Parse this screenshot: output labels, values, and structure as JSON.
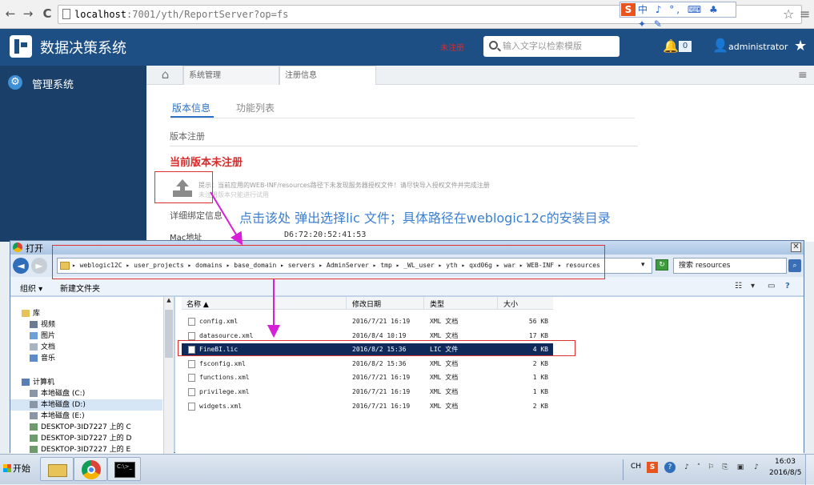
{
  "browser": {
    "back_glyph": "←",
    "forward_glyph": "→",
    "reload_glyph": "C",
    "url_host": "localhost",
    "url_rest": ":7001/yth/ReportServer?op=fs",
    "ime_brand": "S",
    "ime_label": "中 ♪ °, ⌨ ♣ ✦ ✎",
    "star_glyph": "☆",
    "menu_glyph": "≡"
  },
  "app": {
    "title": "数据决策系统",
    "red_header_text": "未注册",
    "search_placeholder": "输入文字以检索模版",
    "bell_glyph": "🔔",
    "notification_count": "0",
    "user_glyph": "👤",
    "username": "administrator",
    "star_glyph": "★"
  },
  "sidebar": {
    "items": [
      {
        "label": "管理系统",
        "icon": "gear-icon",
        "glyph": "⚙"
      }
    ]
  },
  "tabs": {
    "home_glyph": "⌂",
    "items": [
      {
        "label": "系统管理"
      },
      {
        "label": "注册信息"
      }
    ],
    "menu_glyph": "≡"
  },
  "register": {
    "subtabs": [
      "版本信息",
      "功能列表"
    ],
    "section_title": "版本注册",
    "status": "当前版本未注册",
    "hint_line1": "提示：当前应用的WEB-INF/resources路径下未发现服务器授权文件！请尽快导入授权文件并完成注册",
    "hint_line2": "未注册版本只能进行试用",
    "detail_title": "详细绑定信息",
    "mac_label": "Mac地址",
    "mac_value": "D6:72:20:52:41:53"
  },
  "annotation": {
    "text": "点击该处  弹出选择lic 文件；具体路径在weblogic12c的安装目录",
    "box_color": "#e23030",
    "arrow_color": "#d61fd6",
    "text_color": "#3c7fd0"
  },
  "dialog": {
    "title": "打开",
    "close_glyph": "✕",
    "back_glyph": "◄",
    "forward_glyph": "►",
    "path": "▸ weblogic12C ▸ user_projects ▸ domains ▸ base_domain ▸ servers ▸ AdminServer ▸ tmp ▸ _WL_user ▸ yth ▸ qxd06g ▸ war ▸ WEB-INF ▸ resources",
    "dropdown_glyph": "▾",
    "refresh_glyph": "↻",
    "search_value": "搜索 resources",
    "search_go_glyph": "⌕",
    "organize_label": "组织 ▾",
    "newfolder_label": "新建文件夹",
    "view_glyph": "☷",
    "view_drop_glyph": "▾",
    "pane_glyph": "▭",
    "help_glyph": "?",
    "scroll_up_glyph": "▲",
    "nav": [
      {
        "label": "库",
        "color": "#e8c35a",
        "indent": 14
      },
      {
        "label": "视频",
        "color": "#6b7c92",
        "indent": 24
      },
      {
        "label": "图片",
        "color": "#6b9fd6",
        "indent": 24
      },
      {
        "label": "文档",
        "color": "#a9b4c2",
        "indent": 24
      },
      {
        "label": "音乐",
        "color": "#5d8ac9",
        "indent": 24
      },
      {
        "label": "",
        "color": "",
        "indent": 0
      },
      {
        "label": "计算机",
        "color": "#5a7fb6",
        "indent": 14
      },
      {
        "label": "本地磁盘 (C:)",
        "color": "#8a96a6",
        "indent": 24
      },
      {
        "label": "本地磁盘 (D:)",
        "color": "#8a96a6",
        "indent": 24
      },
      {
        "label": "本地磁盘 (E:)",
        "color": "#8a96a6",
        "indent": 24
      },
      {
        "label": "DESKTOP-3ID7227 上的 C",
        "color": "#6e9b6e",
        "indent": 24
      },
      {
        "label": "DESKTOP-3ID7227 上的 D",
        "color": "#6e9b6e",
        "indent": 24
      },
      {
        "label": "DESKTOP-3ID7227 上的 E",
        "color": "#6e9b6e",
        "indent": 24
      }
    ],
    "selected_nav": 8,
    "columns": {
      "name": "名称 ▲",
      "date": "修改日期",
      "type": "类型",
      "size": "大小"
    },
    "files": [
      {
        "name": "config.xml",
        "date": "2016/7/21 16:19",
        "type": "XML 文档",
        "size": "56 KB"
      },
      {
        "name": "datasource.xml",
        "date": "2016/8/4 10:19",
        "type": "XML 文档",
        "size": "17 KB"
      },
      {
        "name": "FineBI.lic",
        "date": "2016/8/2 15:36",
        "type": "LIC 文件",
        "size": "4 KB"
      },
      {
        "name": "fsconfig.xml",
        "date": "2016/8/2 15:36",
        "type": "XML 文档",
        "size": "2 KB"
      },
      {
        "name": "functions.xml",
        "date": "2016/7/21 16:19",
        "type": "XML 文档",
        "size": "1 KB"
      },
      {
        "name": "privilege.xml",
        "date": "2016/7/21 16:19",
        "type": "XML 文档",
        "size": "1 KB"
      },
      {
        "name": "widgets.xml",
        "date": "2016/7/21 16:19",
        "type": "XML 文档",
        "size": "2 KB"
      }
    ],
    "selected_file": 2
  },
  "taskbar": {
    "start_label": "开始",
    "cmd_text": "C:\\>_",
    "lang": "CH",
    "tray": [
      {
        "name": "sogou-icon",
        "glyph": "S"
      },
      {
        "name": "help-icon",
        "glyph": "?"
      },
      {
        "name": "ime-icon",
        "glyph": "♪"
      },
      {
        "name": "expand-tray-icon",
        "glyph": "˄"
      },
      {
        "name": "flag-icon",
        "glyph": "⚐"
      },
      {
        "name": "network-icon",
        "glyph": "⎘"
      },
      {
        "name": "device-icon",
        "glyph": "▣"
      },
      {
        "name": "volume-icon",
        "glyph": "♪"
      }
    ],
    "time": "16:03",
    "date": "2016/8/5"
  }
}
